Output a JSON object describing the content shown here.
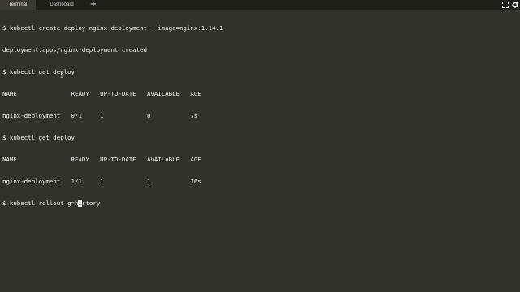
{
  "tabs": [
    {
      "label": "Terminal",
      "active": true
    },
    {
      "label": "Dashboard",
      "active": false
    }
  ],
  "tab_add_icon": "plus-icon",
  "window_controls": [
    "maximize-icon",
    "settings-icon"
  ],
  "colors": {
    "terminal_bg": "#32322c",
    "tabbar_bg": "#1f1f1a",
    "text": "#f2f2ee"
  },
  "terminal": {
    "lines": [
      "$ kubectl create deploy nginx-deployment --image=nginx:1.14.1",
      "deployment.apps/nginx-deployment created",
      "$ kubectl get deploy",
      "NAME               READY   UP-TO-DATE   AVAILABLE   AGE",
      "nginx-deployment   0/1     1            0           7s",
      "$ kubectl get deploy",
      "NAME               READY   UP-TO-DATE   AVAILABLE   AGE",
      "nginx-deployment   1/1     1            1           16s"
    ],
    "current_input_before_cursor": "$ kubectl rollout g=h",
    "cursor_char": "i",
    "current_input_after_cursor": "story"
  }
}
